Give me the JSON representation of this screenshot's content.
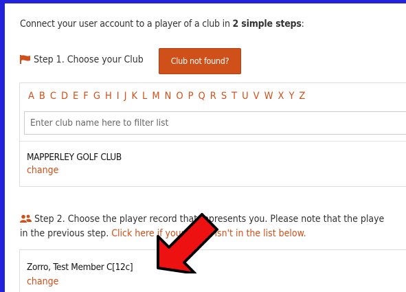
{
  "intro": {
    "text": "Connect your user account to a player of a club in ",
    "bold": "2 simple steps",
    "end": ":"
  },
  "step1": {
    "label": "Step 1. Choose your Club",
    "icon": "flag-icon",
    "button": "Club not found?"
  },
  "alphabet": [
    "A",
    "B",
    "C",
    "D",
    "E",
    "F",
    "G",
    "H",
    "I",
    "J",
    "K",
    "L",
    "M",
    "N",
    "O",
    "P",
    "Q",
    "R",
    "S",
    "T",
    "U",
    "V",
    "W",
    "X",
    "Y",
    "Z"
  ],
  "filter": {
    "placeholder": "Enter club name here to filter list"
  },
  "club": {
    "name": "MAPPERLEY GOLF CLUB",
    "change": "change"
  },
  "step2": {
    "icon": "users-icon",
    "line1": "Step 2. Choose the player record that represents you. Please note that the playe",
    "line2_prefix": "in the previous step. ",
    "line2_link": "Click here if your name isn't in the list below."
  },
  "member": {
    "name": "Zorro, Test Member C[12c]",
    "change": "change"
  },
  "colors": {
    "accent": "#d0501a",
    "frame": "#2222dd",
    "arrow": "#ee1111"
  }
}
